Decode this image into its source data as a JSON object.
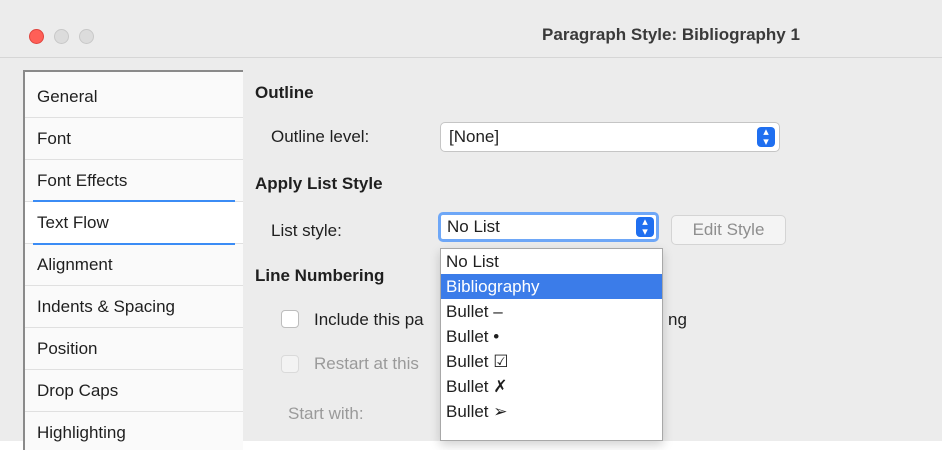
{
  "window": {
    "title": "Paragraph Style: Bibliography 1"
  },
  "sidebar": {
    "items": [
      {
        "label": "General"
      },
      {
        "label": "Font"
      },
      {
        "label": "Font Effects"
      },
      {
        "label": "Text Flow"
      },
      {
        "label": "Alignment"
      },
      {
        "label": "Indents & Spacing"
      },
      {
        "label": "Position"
      },
      {
        "label": "Drop Caps"
      },
      {
        "label": "Highlighting"
      }
    ],
    "active_index": 3
  },
  "outline": {
    "heading": "Outline",
    "level_label": "Outline level:",
    "level_value": "[None]"
  },
  "list_style": {
    "heading": "Apply List Style",
    "label": "List style:",
    "value": "No List",
    "edit_button": "Edit Style",
    "options": [
      "No List",
      "Bibliography",
      "Bullet –",
      "Bullet •",
      "Bullet ☑",
      "Bullet ✗",
      "Bullet ➢"
    ],
    "highlighted": "Bibliography"
  },
  "line_numbering": {
    "heading": "Line Numbering",
    "include_label_left": "Include this pa",
    "include_label_right": "ng",
    "restart_label": "Restart at this",
    "start_with_label": "Start with:"
  },
  "colors": {
    "accent": "#1f6ff0",
    "selection": "#3b7ce9",
    "close": "#ff5f57"
  }
}
